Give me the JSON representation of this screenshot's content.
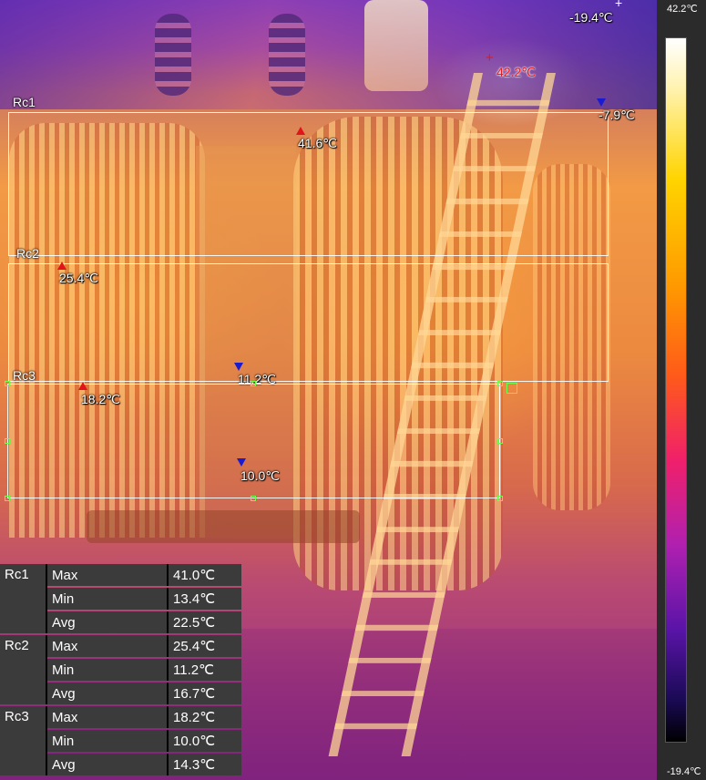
{
  "thermal": {
    "rois": [
      {
        "label": "Rc1",
        "max": "41.0℃",
        "min": "13.4℃",
        "avg": "22.5℃"
      },
      {
        "label": "Rc2",
        "max": "25.4℃",
        "min": "11.2℃",
        "avg": "16.7℃"
      },
      {
        "label": "Rc3",
        "max": "18.2℃",
        "min": "10.0℃",
        "avg": "14.3℃"
      }
    ],
    "markers": {
      "global_min": "-19.4℃",
      "global_max": "42.2℃",
      "rc1_cold": "-7.9℃",
      "rc1_hot": "41.6℃",
      "rc2_hot": "25.4℃",
      "rc2_cold": "11.2℃",
      "rc3_hot": "18.2℃",
      "rc3_cold": "10.0℃"
    },
    "metric_labels": {
      "max": "Max",
      "min": "Min",
      "avg": "Avg"
    }
  },
  "palette": {
    "top_label": "42.2℃",
    "bottom_label": "-19.4℃"
  },
  "icons": {
    "hot_marker": "red-triangle-up-icon",
    "cold_marker": "blue-triangle-down-icon",
    "hotspot": "crosshair-icon"
  },
  "colors": {
    "hot_marker": "#e0141a",
    "cold_marker": "#1a1ad0",
    "roi_border": "#ffffff",
    "roi_handle": "#6cff4e",
    "table_bg": "#3b3b3b"
  }
}
